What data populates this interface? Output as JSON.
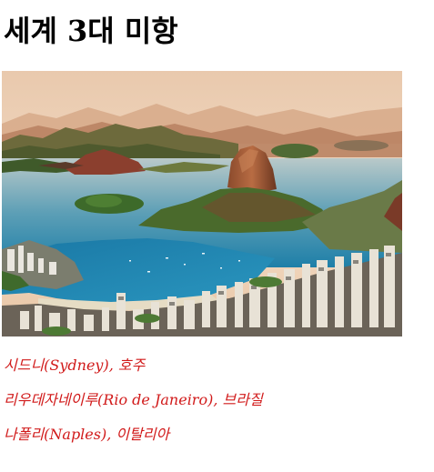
{
  "page": {
    "title": "세계 3대 미항"
  },
  "hero_image": {
    "alt": "Rio de Janeiro harbor with Sugarloaf Mountain"
  },
  "harbors": [
    {
      "label": "시드니(Sydney), 호주"
    },
    {
      "label": "리우데자네이루(Rio de Janeiro), 브라질"
    },
    {
      "label": "나폴리(Naples), 이탈리아"
    }
  ],
  "colors": {
    "list_text": "#d11a1a",
    "title_text": "#000000"
  }
}
